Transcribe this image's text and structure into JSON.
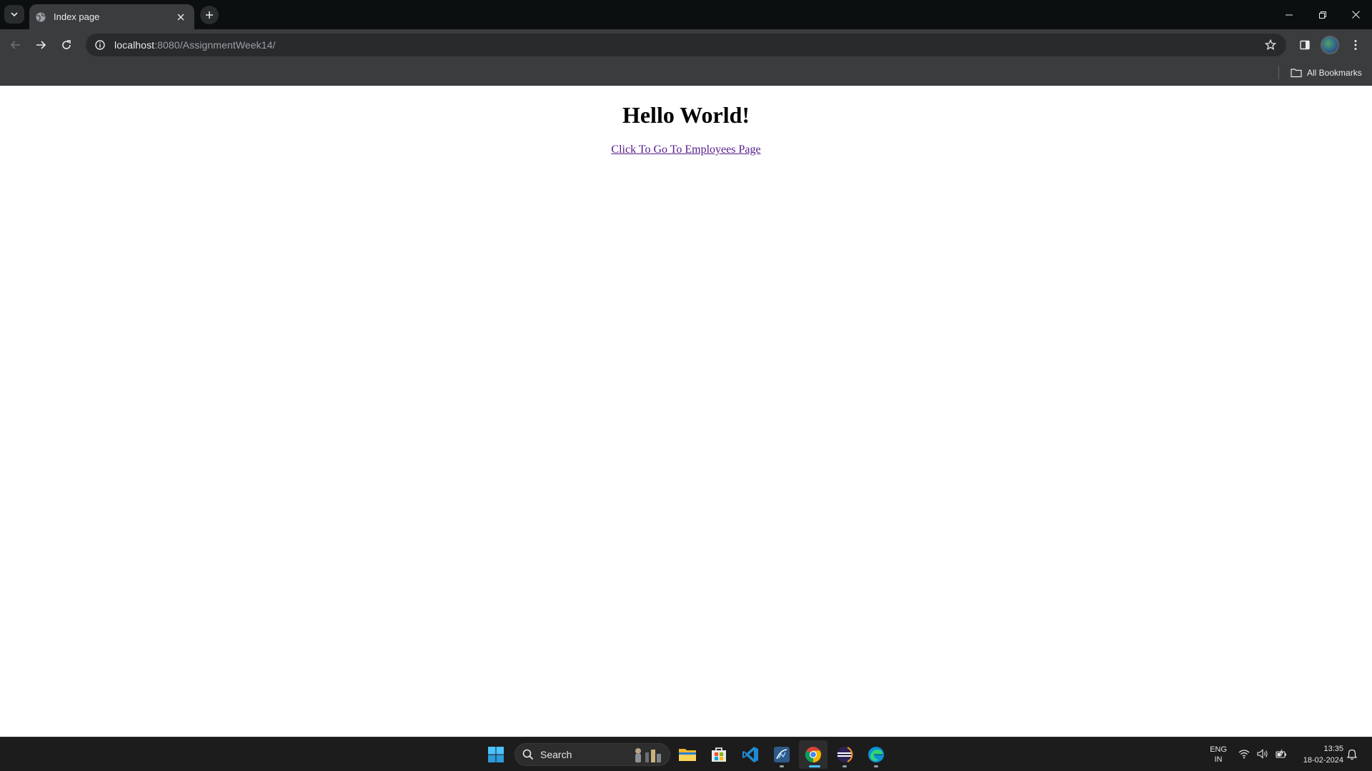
{
  "browser": {
    "tab": {
      "title": "Index page",
      "favicon": "globe-icon",
      "close_icon": "close-icon"
    },
    "new_tab_icon": "plus-icon",
    "tab_search_icon": "chevron-down-icon",
    "window_controls": [
      "minimize-icon",
      "restore-icon",
      "close-icon"
    ],
    "nav": {
      "back": "arrow-left-icon",
      "forward": "arrow-right-icon",
      "reload": "reload-icon"
    },
    "address_bar": {
      "host": "localhost",
      "rest": ":8080/AssignmentWeek14/",
      "site_info_icon": "info-icon",
      "bookmark_icon": "star-icon"
    },
    "toolbar_icons": [
      "side-panel-icon",
      "profile-avatar",
      "menu-kebab-icon"
    ],
    "bookmarks_bar": {
      "all_bookmarks_label": "All Bookmarks",
      "icon": "folder-icon"
    }
  },
  "page": {
    "heading": "Hello World!",
    "link_text": "Click To Go To Employees Page"
  },
  "taskbar": {
    "start_icon": "windows-start-icon",
    "search_label": "Search",
    "apps": [
      "file-explorer-icon",
      "microsoft-store-icon",
      "vscode-icon",
      "mysql-workbench-icon",
      "chrome-icon",
      "eclipse-icon",
      "edge-icon"
    ],
    "active_app": "chrome-icon",
    "tray": {
      "lang_line1": "ENG",
      "lang_line2": "IN",
      "icons": [
        "wifi-icon",
        "volume-icon",
        "battery-icon"
      ]
    },
    "clock": {
      "time": "13:35",
      "date": "18-02-2024"
    },
    "notification_icon": "bell-icon"
  },
  "colors": {
    "link_visited": "#551a8b",
    "chrome_dark": "#3b3c3e",
    "taskbar": "#1c1c1c",
    "active_indicator": "#4cc2ff"
  }
}
